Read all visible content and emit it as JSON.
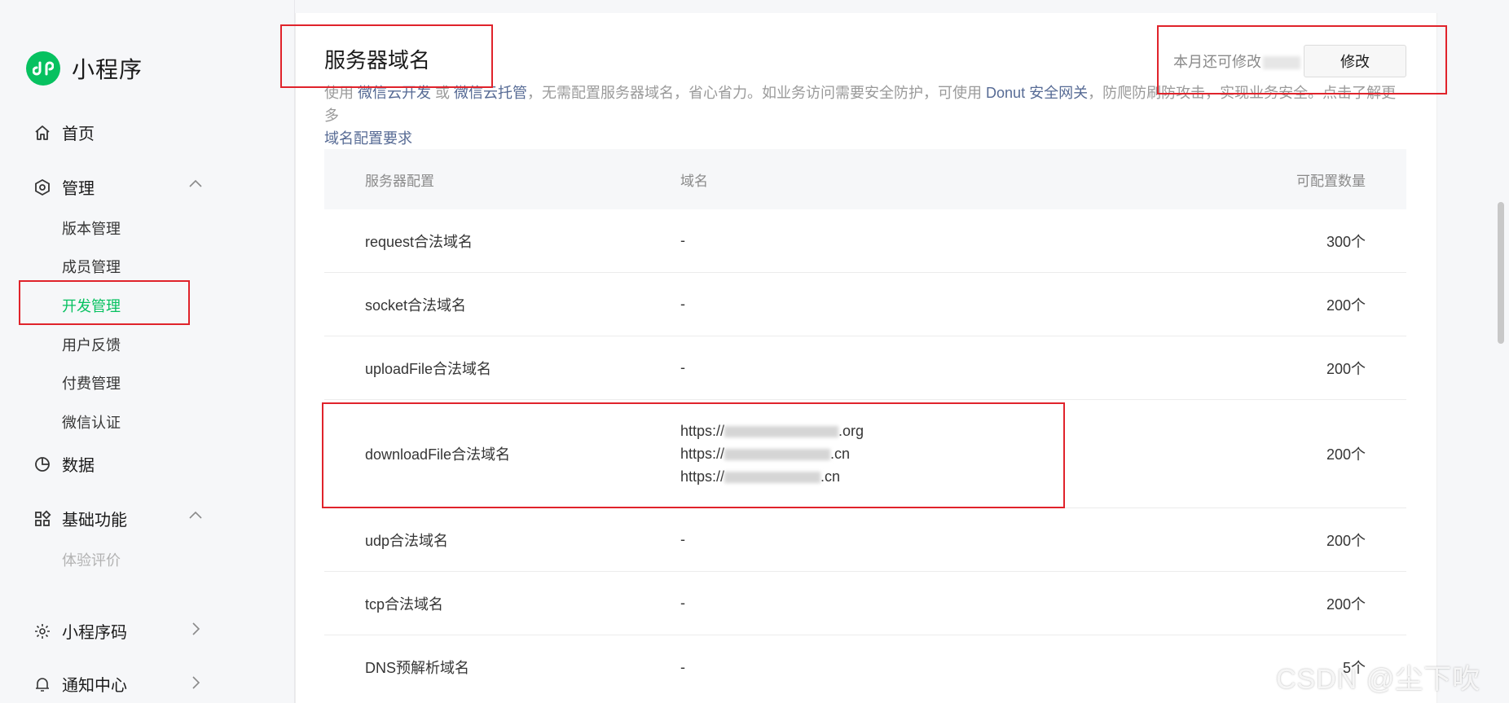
{
  "app": {
    "title": "小程序"
  },
  "sidebar": {
    "home": "首页",
    "manage": {
      "label": "管理",
      "items": [
        "版本管理",
        "成员管理",
        "开发管理",
        "用户反馈",
        "付费管理",
        "微信认证"
      ]
    },
    "data": "数据",
    "basic": {
      "label": "基础功能",
      "items": [
        "体验评价"
      ]
    },
    "qrcode": "小程序码",
    "notify": "通知中心"
  },
  "main": {
    "title": "服务器域名",
    "desc": {
      "p1": "使用 ",
      "link1": "微信云开发",
      "p2": " 或 ",
      "link2": "微信云托管",
      "p3": "，无需配置服务器域名，省心省力。如业务访问需要安全防护，可使用 ",
      "link3": "Donut 安全网关",
      "p4": "，防爬防刷防攻击，实现业务安全。点击了解更多",
      "link4": "域名配置要求"
    },
    "quota_text": "本月还可修改",
    "modify_button": "修改"
  },
  "table": {
    "headers": [
      "服务器配置",
      "域名",
      "可配置数量"
    ],
    "rows": [
      {
        "name": "request合法域名",
        "domain": "-",
        "count": "300个"
      },
      {
        "name": "socket合法域名",
        "domain": "-",
        "count": "200个"
      },
      {
        "name": "uploadFile合法域名",
        "domain": "-",
        "count": "200个"
      },
      {
        "name": "downloadFile合法域名",
        "domains": [
          {
            "prefix": "https://",
            "suffix": ".org"
          },
          {
            "prefix": "https://",
            "suffix": ".cn"
          },
          {
            "prefix": "https://",
            "suffix": ".cn"
          }
        ],
        "count": "200个"
      },
      {
        "name": "udp合法域名",
        "domain": "-",
        "count": "200个"
      },
      {
        "name": "tcp合法域名",
        "domain": "-",
        "count": "200个"
      },
      {
        "name": "DNS预解析域名",
        "domain": "-",
        "count": "5个"
      }
    ]
  },
  "watermark": "CSDN @尘下吹霜",
  "colors": {
    "accent": "#07c160",
    "link": "#576b95",
    "annotation": "#e0232b"
  }
}
